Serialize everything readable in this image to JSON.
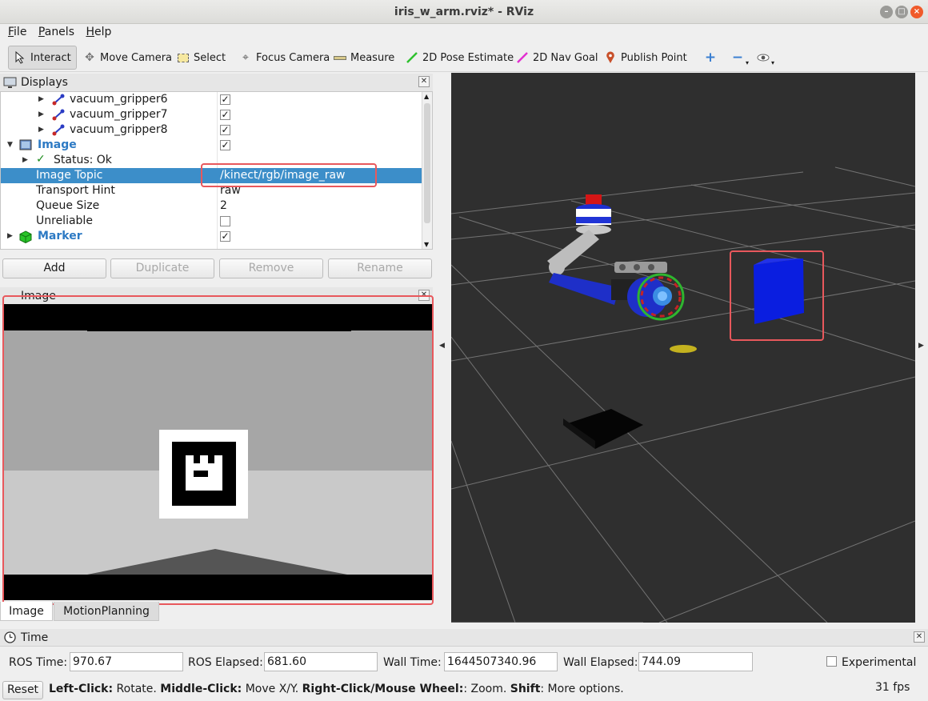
{
  "window": {
    "title": "iris_w_arm.rviz* - RViz"
  },
  "menu": {
    "file": "File",
    "panels": "Panels",
    "help": "Help"
  },
  "toolbar": {
    "interact": "Interact",
    "move_camera": "Move Camera",
    "select": "Select",
    "focus_camera": "Focus Camera",
    "measure": "Measure",
    "pose_estimate": "2D Pose Estimate",
    "nav_goal": "2D Nav Goal",
    "publish_point": "Publish Point"
  },
  "displays": {
    "header": "Displays",
    "rows": [
      {
        "label": "vacuum_gripper6",
        "checked": true
      },
      {
        "label": "vacuum_gripper7",
        "checked": true
      },
      {
        "label": "vacuum_gripper8",
        "checked": true
      },
      {
        "label": "Image",
        "checked": true
      },
      {
        "label": "Status: Ok"
      },
      {
        "label": "Image Topic",
        "value": "/kinect/rgb/image_raw"
      },
      {
        "label": "Transport Hint",
        "value": "raw"
      },
      {
        "label": "Queue Size",
        "value": "2"
      },
      {
        "label": "Unreliable",
        "checked": false
      },
      {
        "label": "Marker",
        "checked": true
      }
    ],
    "buttons": {
      "add": "Add",
      "duplicate": "Duplicate",
      "remove": "Remove",
      "rename": "Rename"
    }
  },
  "image_panel": {
    "header": "Image"
  },
  "tabs": {
    "image": "Image",
    "motion_planning": "MotionPlanning"
  },
  "time": {
    "header": "Time",
    "ros_time_label": "ROS Time:",
    "ros_time": "970.67",
    "ros_elapsed_label": "ROS Elapsed:",
    "ros_elapsed": "681.60",
    "wall_time_label": "Wall Time:",
    "wall_time": "1644507340.96",
    "wall_elapsed_label": "Wall Elapsed:",
    "wall_elapsed": "744.09",
    "experimental": "Experimental"
  },
  "status": {
    "reset": "Reset",
    "left_click": "Left-Click:",
    "left_click_desc": " Rotate. ",
    "middle_click": "Middle-Click:",
    "middle_click_desc": " Move X/Y. ",
    "right_click": "Right-Click/Mouse Wheel:",
    "right_click_desc": ": Zoom. ",
    "shift": "Shift",
    "shift_desc": ": More options.",
    "fps": "31 fps"
  },
  "colors": {
    "selection": "#3c8ec9",
    "highlight": "#e8585c",
    "viewport_bg": "#2f2f2f"
  }
}
